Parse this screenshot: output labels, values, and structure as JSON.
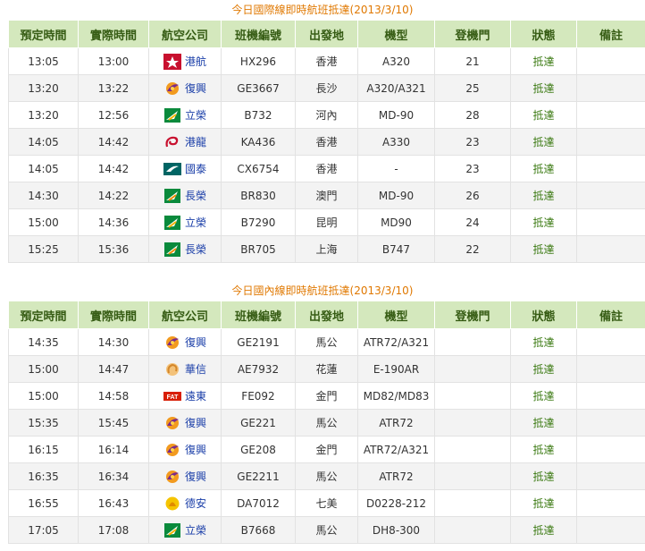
{
  "international": {
    "title": "今日國際線即時航班抵達(2013/3/10)",
    "headers": [
      "預定時間",
      "實際時間",
      "航空公司",
      "班機編號",
      "出發地",
      "機型",
      "登機門",
      "狀態",
      "備註"
    ],
    "rows": [
      {
        "scheduled": "13:05",
        "actual": "13:00",
        "airline": "港航",
        "logo": "hk-airlines-icon",
        "flight": "HX296",
        "origin": "香港",
        "aircraft": "A320",
        "gate": "21",
        "status": "抵達",
        "note": ""
      },
      {
        "scheduled": "13:20",
        "actual": "13:22",
        "airline": "復興",
        "logo": "transasia-icon",
        "flight": "GE3667",
        "origin": "長沙",
        "aircraft": "A320/A321",
        "gate": "25",
        "status": "抵達",
        "note": ""
      },
      {
        "scheduled": "13:20",
        "actual": "12:56",
        "airline": "立榮",
        "logo": "uni-air-icon",
        "flight": "B732",
        "origin": "河內",
        "aircraft": "MD-90",
        "gate": "28",
        "status": "抵達",
        "note": ""
      },
      {
        "scheduled": "14:05",
        "actual": "14:42",
        "airline": "港龍",
        "logo": "dragonair-icon",
        "flight": "KA436",
        "origin": "香港",
        "aircraft": "A330",
        "gate": "23",
        "status": "抵達",
        "note": ""
      },
      {
        "scheduled": "14:05",
        "actual": "14:42",
        "airline": "國泰",
        "logo": "cathay-icon",
        "flight": "CX6754",
        "origin": "香港",
        "aircraft": "-",
        "gate": "23",
        "status": "抵達",
        "note": ""
      },
      {
        "scheduled": "14:30",
        "actual": "14:22",
        "airline": "長榮",
        "logo": "eva-air-icon",
        "flight": "BR830",
        "origin": "澳門",
        "aircraft": "MD-90",
        "gate": "26",
        "status": "抵達",
        "note": ""
      },
      {
        "scheduled": "15:00",
        "actual": "14:36",
        "airline": "立榮",
        "logo": "uni-air-icon",
        "flight": "B7290",
        "origin": "昆明",
        "aircraft": "MD90",
        "gate": "24",
        "status": "抵達",
        "note": ""
      },
      {
        "scheduled": "15:25",
        "actual": "15:36",
        "airline": "長榮",
        "logo": "eva-air-icon",
        "flight": "BR705",
        "origin": "上海",
        "aircraft": "B747",
        "gate": "22",
        "status": "抵達",
        "note": ""
      }
    ]
  },
  "domestic": {
    "title": "今日國內線即時航班抵達(2013/3/10)",
    "headers": [
      "預定時間",
      "實際時間",
      "航空公司",
      "班機編號",
      "出發地",
      "機型",
      "登機門",
      "狀態",
      "備註"
    ],
    "rows": [
      {
        "scheduled": "14:35",
        "actual": "14:30",
        "airline": "復興",
        "logo": "transasia-icon",
        "flight": "GE2191",
        "origin": "馬公",
        "aircraft": "ATR72/A321",
        "gate": "",
        "status": "抵達",
        "note": ""
      },
      {
        "scheduled": "15:00",
        "actual": "14:47",
        "airline": "華信",
        "logo": "mandarin-icon",
        "flight": "AE7932",
        "origin": "花蓮",
        "aircraft": "E-190AR",
        "gate": "",
        "status": "抵達",
        "note": ""
      },
      {
        "scheduled": "15:00",
        "actual": "14:58",
        "airline": "遠東",
        "logo": "far-eastern-icon",
        "flight": "FE092",
        "origin": "金門",
        "aircraft": "MD82/MD83",
        "gate": "",
        "status": "抵達",
        "note": ""
      },
      {
        "scheduled": "15:35",
        "actual": "15:45",
        "airline": "復興",
        "logo": "transasia-icon",
        "flight": "GE221",
        "origin": "馬公",
        "aircraft": "ATR72",
        "gate": "",
        "status": "抵達",
        "note": ""
      },
      {
        "scheduled": "16:15",
        "actual": "16:14",
        "airline": "復興",
        "logo": "transasia-icon",
        "flight": "GE208",
        "origin": "金門",
        "aircraft": "ATR72/A321",
        "gate": "",
        "status": "抵達",
        "note": ""
      },
      {
        "scheduled": "16:35",
        "actual": "16:34",
        "airline": "復興",
        "logo": "transasia-icon",
        "flight": "GE2211",
        "origin": "馬公",
        "aircraft": "ATR72",
        "gate": "",
        "status": "抵達",
        "note": ""
      },
      {
        "scheduled": "16:55",
        "actual": "16:43",
        "airline": "德安",
        "logo": "daily-air-icon",
        "flight": "DA7012",
        "origin": "七美",
        "aircraft": "D0228-212",
        "gate": "",
        "status": "抵達",
        "note": ""
      },
      {
        "scheduled": "17:05",
        "actual": "17:08",
        "airline": "立榮",
        "logo": "uni-air-icon",
        "flight": "B7668",
        "origin": "馬公",
        "aircraft": "DH8-300",
        "gate": "",
        "status": "抵達",
        "note": ""
      }
    ]
  }
}
